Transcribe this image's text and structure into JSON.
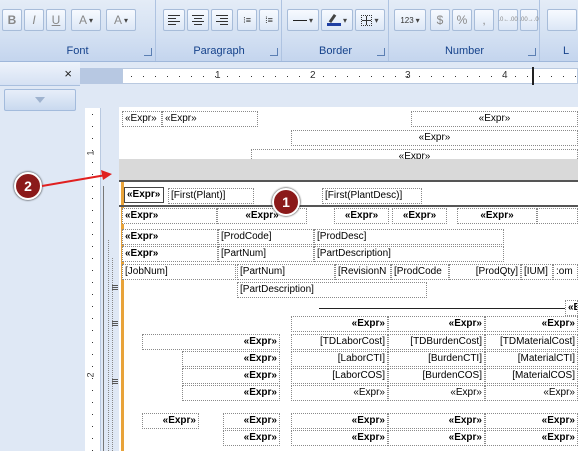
{
  "ribbon": {
    "groups": [
      {
        "name": "Font",
        "label": "Font"
      },
      {
        "name": "Paragraph",
        "label": "Paragraph"
      },
      {
        "name": "Border",
        "label": "Border"
      },
      {
        "name": "Number",
        "label": "Number"
      },
      {
        "name": "partial",
        "label": "L"
      }
    ],
    "font_buttons": {
      "bold": "B",
      "italic": "I",
      "underline": "U",
      "font_color": "A",
      "grow": "A"
    },
    "number_buttons": {
      "format": "123",
      "currency": "$",
      "percent": "%",
      "comma": ",",
      "inc_dec": ".0←.00",
      "dec_dec": ".00→.0"
    }
  },
  "left_pane": {
    "close": "×"
  },
  "ruler": {
    "marks": [
      "1",
      "2",
      "3",
      "4"
    ],
    "vmarks": [
      "1",
      "2"
    ]
  },
  "annotations": {
    "badge1": "1",
    "badge2": "2"
  },
  "report": {
    "header_row": [
      "«Expr»",
      "«Expr»",
      "«Expr»",
      "«Expr»",
      "«Expr»"
    ],
    "plant_row": {
      "expr": "«Expr»",
      "plant": "[First(Plant)]",
      "desc": "[First(PlantDesc)]"
    },
    "group_row": [
      "«Expr»",
      "«Expr»",
      "«Expr»",
      "«Expr»",
      "«Expr»"
    ],
    "prod_row": {
      "expr": "«Expr»",
      "code": "[ProdCode]",
      "desc": "[ProdDesc]"
    },
    "part_row": {
      "expr": "«Expr»",
      "num": "[PartNum]",
      "desc": "[PartDescription]"
    },
    "detail_row": {
      "job": "[JobNum]",
      "part": "[PartNum]",
      "rev": "[RevisionN",
      "code": "[ProdCode",
      "qty": "[ProdQty]",
      "ium": "[IUM]",
      "com": ":om"
    },
    "partdesc": "[PartDescription]",
    "expr_a": "«Expr»",
    "tot_head": [
      "«Expr»",
      "«Expr»",
      "«Expr»"
    ],
    "tot_rows": [
      {
        "label": "«Expr»",
        "c1": "[TDLaborCost]",
        "c2": "[TDBurdenCost]",
        "c3": "[TDMaterialCost]"
      },
      {
        "label": "«Expr»",
        "c1": "[LaborCTI]",
        "c2": "[BurdenCTI]",
        "c3": "[MaterialCTI]"
      },
      {
        "label": "«Expr»",
        "c1": "[LaborCOS]",
        "c2": "[BurdenCOS]",
        "c3": "[MaterialCOS]"
      },
      {
        "label": "«Expr»",
        "c1": "«Expr»",
        "c2": "«Expr»",
        "c3": "«Expr»"
      }
    ],
    "bottom_rows": [
      {
        "a": "«Expr»",
        "b": "«Expr»",
        "c1": "«Expr»",
        "c2": "«Expr»",
        "c3": "«Expr»"
      },
      {
        "b": "«Expr»",
        "c1": "«Expr»",
        "c2": "«Expr»",
        "c3": "«Expr»"
      }
    ]
  }
}
